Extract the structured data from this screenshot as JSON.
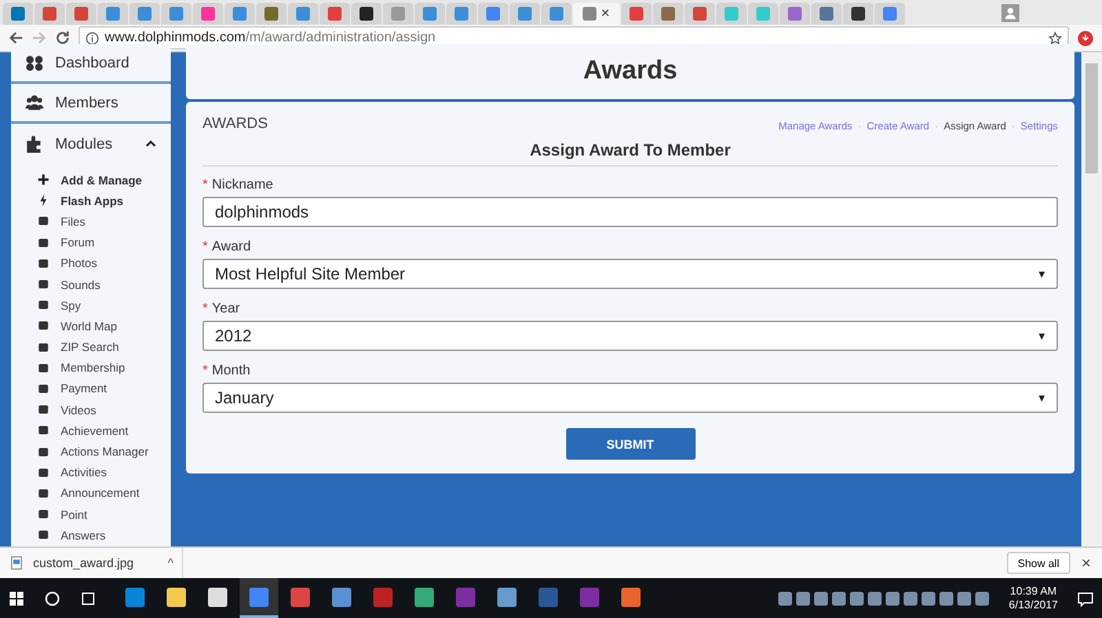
{
  "browser": {
    "tabs": [
      {
        "color": "#0077b5",
        "selected": false
      },
      {
        "color": "#d44638",
        "selected": false
      },
      {
        "color": "#d44638",
        "selected": false
      },
      {
        "color": "#3b8fd9",
        "selected": false
      },
      {
        "color": "#3b8fd9",
        "selected": false
      },
      {
        "color": "#3b8fd9",
        "selected": false
      },
      {
        "color": "#ff3399",
        "selected": false
      },
      {
        "color": "#3b8fd9",
        "selected": false
      },
      {
        "color": "#7a6a2a",
        "selected": false
      },
      {
        "color": "#3b8fd9",
        "selected": false
      },
      {
        "color": "#e04040",
        "selected": false
      },
      {
        "color": "#222222",
        "selected": false
      },
      {
        "color": "#999999",
        "selected": false
      },
      {
        "color": "#3b8fd9",
        "selected": false
      },
      {
        "color": "#3b8fd9",
        "selected": false
      },
      {
        "color": "#4285f4",
        "selected": false
      },
      {
        "color": "#3b8fd9",
        "selected": false
      },
      {
        "color": "#3b8fd9",
        "selected": false
      },
      {
        "color": "#888888",
        "selected": true
      },
      {
        "color": "#e04040",
        "selected": false
      },
      {
        "color": "#8a6a4a",
        "selected": false
      },
      {
        "color": "#d44638",
        "selected": false
      },
      {
        "color": "#33cccc",
        "selected": false
      },
      {
        "color": "#33cccc",
        "selected": false
      },
      {
        "color": "#9966cc",
        "selected": false
      },
      {
        "color": "#557799",
        "selected": false
      },
      {
        "color": "#333333",
        "selected": false
      },
      {
        "color": "#4285f4",
        "selected": false
      }
    ],
    "tab_close": "×",
    "url_host": "www.dolphinmods.com",
    "url_path": "/m/award/administration/assign"
  },
  "sidebar": {
    "items": [
      {
        "label": "Dashboard"
      },
      {
        "label": "Members"
      },
      {
        "label": "Modules",
        "expanded": true
      }
    ],
    "modules": [
      {
        "label": "Add & Manage",
        "bold": true
      },
      {
        "label": "Flash Apps",
        "bold": true
      },
      {
        "label": "Files",
        "bold": false
      },
      {
        "label": "Forum",
        "bold": false
      },
      {
        "label": "Photos",
        "bold": false
      },
      {
        "label": "Sounds",
        "bold": false
      },
      {
        "label": "Spy",
        "bold": false
      },
      {
        "label": "World Map",
        "bold": false
      },
      {
        "label": "ZIP Search",
        "bold": false
      },
      {
        "label": "Membership",
        "bold": false
      },
      {
        "label": "Payment",
        "bold": false
      },
      {
        "label": "Videos",
        "bold": false
      },
      {
        "label": "Achievement",
        "bold": false
      },
      {
        "label": "Actions Manager",
        "bold": false
      },
      {
        "label": "Activities",
        "bold": false
      },
      {
        "label": "Announcement",
        "bold": false
      },
      {
        "label": "Point",
        "bold": false
      },
      {
        "label": "Answers",
        "bold": false
      }
    ]
  },
  "page": {
    "title": "Awards",
    "section": "AWARDS",
    "links": [
      {
        "label": "Manage Awards",
        "selected": false
      },
      {
        "label": "Create Award",
        "selected": false
      },
      {
        "label": "Assign Award",
        "selected": true
      },
      {
        "label": "Settings",
        "selected": false
      }
    ],
    "separator": "·",
    "form_title": "Assign Award To Member",
    "fields": [
      {
        "kind": "text",
        "required": true,
        "label": "Nickname",
        "value": "dolphinmods"
      },
      {
        "kind": "select",
        "required": true,
        "label": "Award",
        "value": "Most Helpful Site Member"
      },
      {
        "kind": "select",
        "required": true,
        "label": "Year",
        "value": "2012"
      },
      {
        "kind": "select",
        "required": true,
        "label": "Month",
        "value": "January"
      }
    ],
    "required_mark": "*",
    "select_arrow": "▾",
    "submit": "SUBMIT"
  },
  "downloads": {
    "file": "custom_award.jpg",
    "caret": "^",
    "show_all": "Show all",
    "close": "×"
  },
  "taskbar": {
    "time": "10:39 AM",
    "date": "6/13/2017"
  }
}
